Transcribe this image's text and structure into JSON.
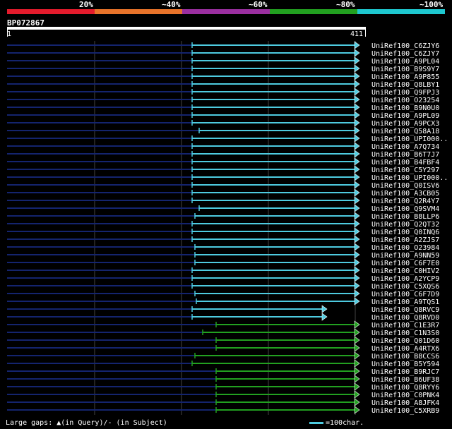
{
  "legend": {
    "labels": [
      "20%",
      "~40%",
      "~60%",
      "~80%",
      "~100%"
    ],
    "colors": [
      "#e41b2c",
      "#e8732a",
      "#9b2fa0",
      "#22a020",
      "#1ec8d0"
    ]
  },
  "query": {
    "title": "BP072867",
    "start": "1",
    "end": "411",
    "length": 411
  },
  "colors": {
    "cyan": "#4ecbe0",
    "green": "#22a020",
    "navy": "#14246e",
    "grid": "#444444"
  },
  "hits": [
    {
      "name": "UniRef100_C6ZJY6",
      "start": 272,
      "end": 502,
      "color": "cyan"
    },
    {
      "name": "UniRef100_C6ZJY7",
      "start": 272,
      "end": 502,
      "color": "cyan"
    },
    {
      "name": "UniRef100_A9PL04",
      "start": 272,
      "end": 502,
      "color": "cyan"
    },
    {
      "name": "UniRef100_B9S9Y7",
      "start": 272,
      "end": 502,
      "color": "cyan"
    },
    {
      "name": "UniRef100_A9P855",
      "start": 272,
      "end": 502,
      "color": "cyan"
    },
    {
      "name": "UniRef100_Q8LBY1",
      "start": 272,
      "end": 502,
      "color": "cyan"
    },
    {
      "name": "UniRef100_Q9FPJ3",
      "start": 272,
      "end": 502,
      "color": "cyan"
    },
    {
      "name": "UniRef100_O23254",
      "start": 272,
      "end": 502,
      "color": "cyan"
    },
    {
      "name": "UniRef100_B9N0U0",
      "start": 272,
      "end": 502,
      "color": "cyan"
    },
    {
      "name": "UniRef100_A9PL09",
      "start": 272,
      "end": 502,
      "color": "cyan"
    },
    {
      "name": "UniRef100_A9PCX3",
      "start": 272,
      "end": 502,
      "color": "cyan"
    },
    {
      "name": "UniRef100_Q58A18",
      "start": 282,
      "end": 502,
      "color": "cyan"
    },
    {
      "name": "UniRef100_UPI000..",
      "start": 272,
      "end": 502,
      "color": "cyan"
    },
    {
      "name": "UniRef100_A7Q734",
      "start": 272,
      "end": 502,
      "color": "cyan"
    },
    {
      "name": "UniRef100_B6T7J7",
      "start": 272,
      "end": 502,
      "color": "cyan"
    },
    {
      "name": "UniRef100_B4FBF4",
      "start": 272,
      "end": 502,
      "color": "cyan"
    },
    {
      "name": "UniRef100_C5Y297",
      "start": 272,
      "end": 502,
      "color": "cyan"
    },
    {
      "name": "UniRef100_UPI000..",
      "start": 272,
      "end": 502,
      "color": "cyan"
    },
    {
      "name": "UniRef100_Q0ISV6",
      "start": 272,
      "end": 502,
      "color": "cyan"
    },
    {
      "name": "UniRef100_A3CB05",
      "start": 272,
      "end": 502,
      "color": "cyan"
    },
    {
      "name": "UniRef100_Q2R4Y7",
      "start": 272,
      "end": 502,
      "color": "cyan"
    },
    {
      "name": "UniRef100_Q9SVM4",
      "start": 282,
      "end": 502,
      "color": "cyan"
    },
    {
      "name": "UniRef100_B8LLP6",
      "start": 276,
      "end": 502,
      "color": "cyan"
    },
    {
      "name": "UniRef100_Q2QT32",
      "start": 272,
      "end": 502,
      "color": "cyan"
    },
    {
      "name": "UniRef100_Q0INQ6",
      "start": 272,
      "end": 502,
      "color": "cyan"
    },
    {
      "name": "UniRef100_A2ZJS7",
      "start": 272,
      "end": 502,
      "color": "cyan"
    },
    {
      "name": "UniRef100_O23984",
      "start": 276,
      "end": 502,
      "color": "cyan"
    },
    {
      "name": "UniRef100_A9NN59",
      "start": 276,
      "end": 502,
      "color": "cyan"
    },
    {
      "name": "UniRef100_C6F7E0",
      "start": 276,
      "end": 502,
      "color": "cyan"
    },
    {
      "name": "UniRef100_C0HIV2",
      "start": 272,
      "end": 502,
      "color": "cyan"
    },
    {
      "name": "UniRef100_A2YCP9",
      "start": 272,
      "end": 502,
      "color": "cyan"
    },
    {
      "name": "UniRef100_C5XQS6",
      "start": 272,
      "end": 502,
      "color": "cyan"
    },
    {
      "name": "UniRef100_C6F7D9",
      "start": 276,
      "end": 502,
      "color": "cyan"
    },
    {
      "name": "UniRef100_A9TQS1",
      "start": 278,
      "end": 502,
      "color": "cyan"
    },
    {
      "name": "UniRef100_Q8RVC9",
      "start": 272,
      "end": 456,
      "color": "cyan"
    },
    {
      "name": "UniRef100_Q8RVD0",
      "start": 272,
      "end": 456,
      "color": "cyan"
    },
    {
      "name": "UniRef100_C1E3R7",
      "start": 306,
      "end": 502,
      "color": "green"
    },
    {
      "name": "UniRef100_C1N3S0",
      "start": 287,
      "end": 502,
      "color": "green"
    },
    {
      "name": "UniRef100_Q01D60",
      "start": 306,
      "end": 502,
      "color": "green"
    },
    {
      "name": "UniRef100_A4RTX6",
      "start": 306,
      "end": 502,
      "color": "green"
    },
    {
      "name": "UniRef100_B8CCS6",
      "start": 276,
      "end": 502,
      "color": "green"
    },
    {
      "name": "UniRef100_B5Y594",
      "start": 272,
      "end": 502,
      "color": "green"
    },
    {
      "name": "UniRef100_B9RJC7",
      "start": 306,
      "end": 502,
      "color": "green"
    },
    {
      "name": "UniRef100_B6UF38",
      "start": 306,
      "end": 502,
      "color": "green"
    },
    {
      "name": "UniRef100_Q8RYY6",
      "start": 306,
      "end": 502,
      "color": "green"
    },
    {
      "name": "UniRef100_C0PNK4",
      "start": 306,
      "end": 502,
      "color": "green"
    },
    {
      "name": "UniRef100_A8JFK4",
      "start": 306,
      "end": 502,
      "color": "green"
    },
    {
      "name": "UniRef100_C5XRB9",
      "start": 306,
      "end": 502,
      "color": "green"
    }
  ],
  "footer": {
    "gaps_text": "Large gaps: ▲(in Query)/- (in Subject)",
    "scale_text": "=100char."
  }
}
